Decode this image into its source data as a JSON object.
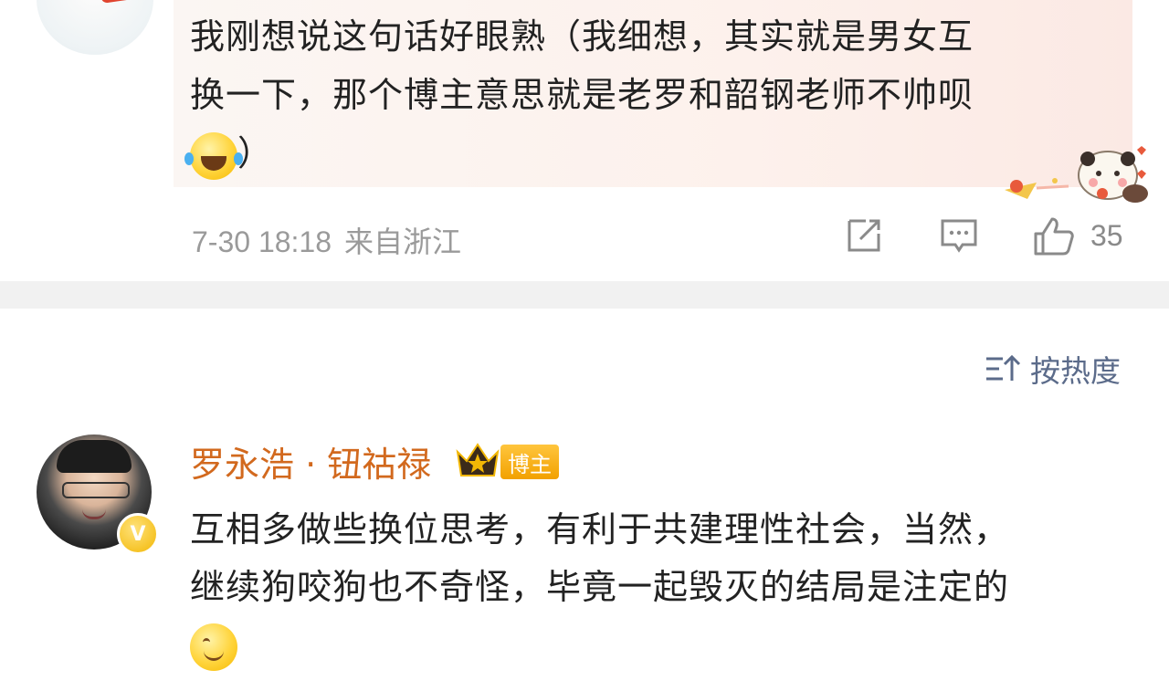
{
  "comment1": {
    "line1": "我刚想说这句话好眼熟（我细想，其实就是男女互",
    "line2": "换一下，那个博主意思就是老罗和韶钢老师不帅呗",
    "line3_close": "）",
    "emoji": "laughing-tears-emoji",
    "time": "7-30 18:18",
    "source": "来自浙江",
    "likes": "35",
    "icons": [
      "share-icon",
      "comment-icon",
      "like-icon"
    ]
  },
  "sort": {
    "label": "按热度",
    "icon": "sort-icon"
  },
  "comment2": {
    "author": "罗永浩 · 钮祜禄",
    "badge": "博主",
    "verify_badge": "V",
    "line1": "互相多做些换位思考，有利于共建理性社会，当然，",
    "line2": "继续狗咬狗也不奇怪，毕竟一起毁灭的结局是注定的",
    "emoji": "smile-emoji"
  },
  "colors": {
    "author": "#d2691e",
    "meta": "#9a9a9a",
    "sort": "#5b6b8a",
    "badge": "#f2a100",
    "divider": "#f1f1f1"
  }
}
